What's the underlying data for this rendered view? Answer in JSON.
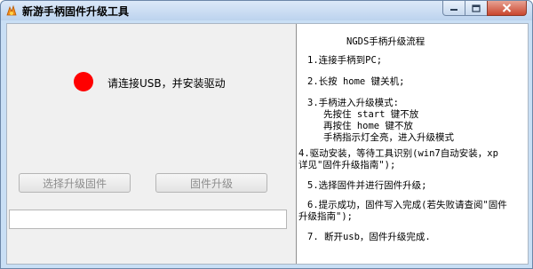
{
  "window": {
    "title": "新游手柄固件升级工具",
    "icon": "app-logo-icon",
    "controls": [
      "minimize-icon",
      "maximize-icon",
      "close-icon"
    ]
  },
  "left": {
    "status_color": "#ff0000",
    "status_text": "请连接USB，并安装驱动",
    "buttons": {
      "select_firmware": "选择升级固件",
      "upgrade_firmware": "固件升级"
    },
    "progress": 0
  },
  "steps": {
    "title": "NGDS手柄升级流程",
    "lines": [
      "1.连接手柄到PC;",
      "2.长按 home 键关机;",
      "3.手柄进入升级模式:",
      "先按住 start 键不放",
      "再按住 home 键不放",
      "手柄指示灯全亮，进入升级模式",
      "4.驱动安装，等待工具识别(win7自动安装，xp",
      "详见\"固件升级指南\");",
      "5.选择固件并进行固件升级;",
      "6.提示成功，固件写入完成(若失败请查阅\"固件",
      "升级指南\");",
      "7. 断开usb，固件升级完成."
    ]
  }
}
